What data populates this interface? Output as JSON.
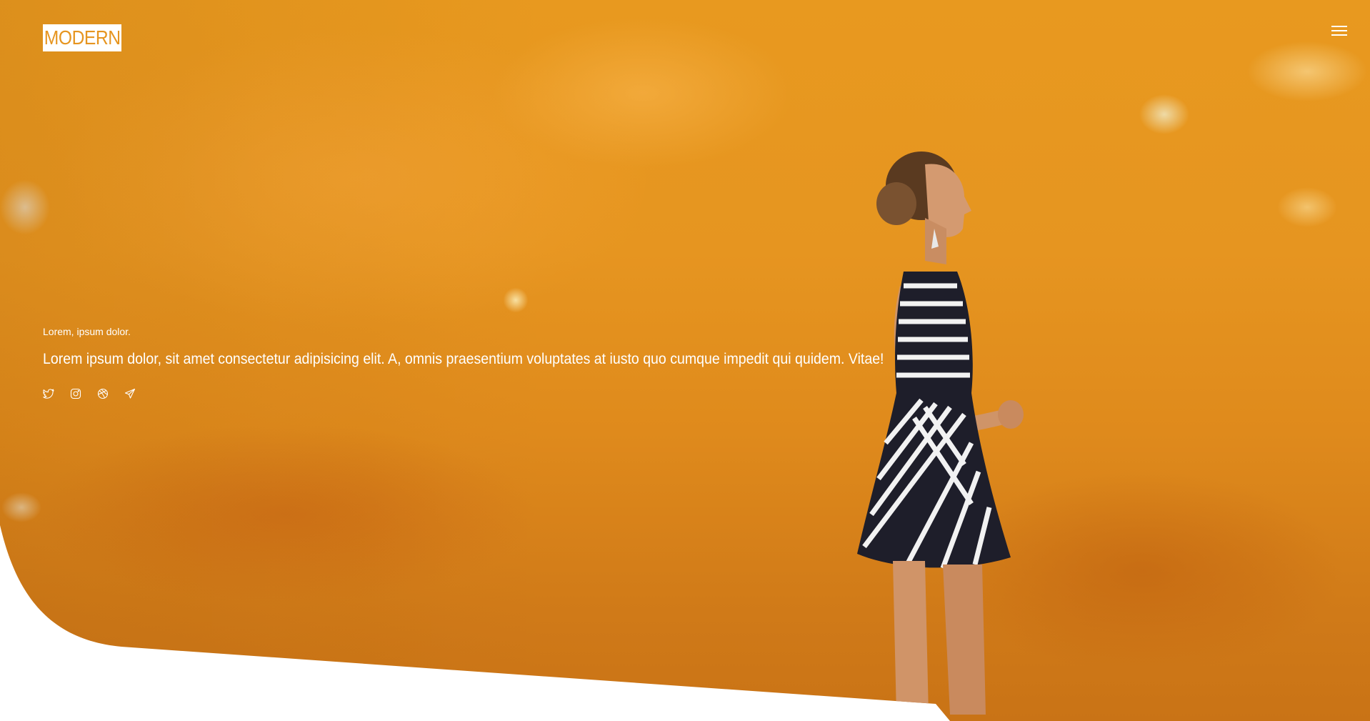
{
  "brand": {
    "logo_text": "MODERN",
    "accent_color": "#e69520",
    "logo_bg_color": "#ffffff"
  },
  "header": {
    "menu_icon": "hamburger-menu-icon"
  },
  "hero": {
    "eyebrow": "Lorem, ipsum dolor.",
    "headline": "Lorem ipsum dolor, sit amet consectetur adipisicing elit. A, omnis praesentium voluptates at iusto quo cumque impedit qui quidem. Vitae!",
    "background": "woman-in-striped-dress-against-orange-wall",
    "socials": [
      {
        "name": "twitter",
        "icon": "twitter-icon"
      },
      {
        "name": "instagram",
        "icon": "instagram-icon"
      },
      {
        "name": "dribbble",
        "icon": "dribbble-icon"
      },
      {
        "name": "telegram",
        "icon": "telegram-icon"
      }
    ]
  }
}
